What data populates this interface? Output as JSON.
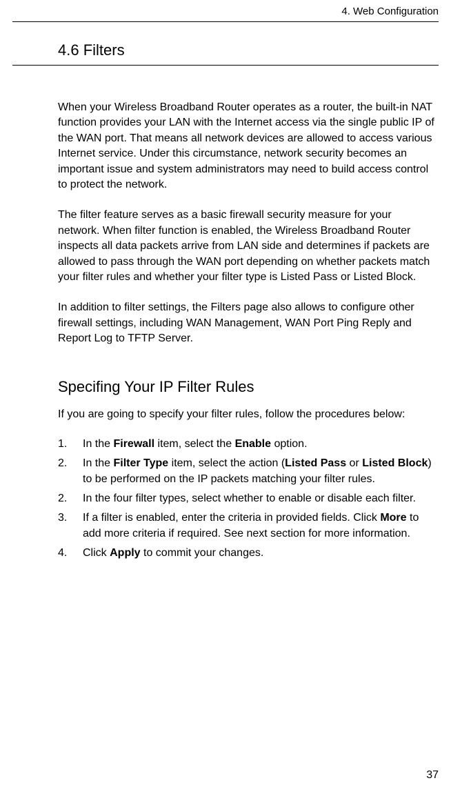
{
  "header": {
    "chapter": "4. Web Configuration"
  },
  "section": {
    "title": "4.6 Filters"
  },
  "paragraphs": {
    "p1": "When your Wireless Broadband Router operates as a router, the built-in NAT function provides your LAN with the Internet access via the single public IP of the WAN port. That means all network devices are allowed to access various Internet service. Under this circumstance, network security becomes an important issue and system administrators may need to build access control to protect the network.",
    "p2": "The filter feature serves as a basic firewall security measure for your network. When filter function is enabled, the Wireless Broadband Router inspects all data packets arrive from LAN side and determines if packets are allowed to pass through the WAN port depending on whether packets match your filter rules and whether your filter type is Listed Pass or Listed Block.",
    "p3": "In addition to filter settings, the Filters page also allows to configure other firewall settings, including WAN Management, WAN Port Ping Reply and Report Log to TFTP Server."
  },
  "subsection": {
    "title": "Specifing Your IP Filter Rules",
    "intro": "If you are going to specify your filter rules, follow the procedures below:"
  },
  "steps": {
    "s1": {
      "marker": "1.",
      "pre": "In the ",
      "bold1": "Firewall",
      "mid1": " item, select the ",
      "bold2": "Enable",
      "post": " option."
    },
    "s2": {
      "marker": "2.",
      "pre": "In the ",
      "bold1": "Filter Type",
      "mid1": " item, select the action (",
      "bold2": "Listed Pass",
      "mid2": " or ",
      "bold3": "Listed Block",
      "post": ") to be performed on the IP packets matching your filter rules."
    },
    "s3": {
      "marker": "2.",
      "text": "In the four filter types, select whether to enable or disable each filter."
    },
    "s4": {
      "marker": "3.",
      "pre": "If a filter is enabled, enter the criteria in provided fields. Click ",
      "bold1": "More",
      "post": " to add more criteria if required. See next section for more information."
    },
    "s5": {
      "marker": "4.",
      "pre": "Click ",
      "bold1": "Apply",
      "post": " to commit your changes."
    }
  },
  "footer": {
    "page_number": "37"
  }
}
